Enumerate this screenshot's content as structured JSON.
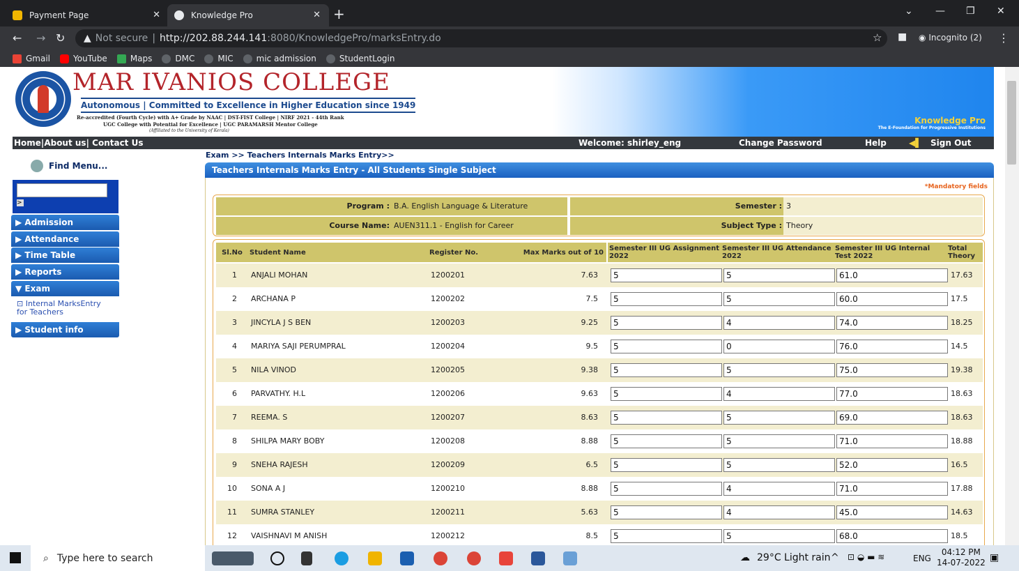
{
  "browser": {
    "tabs": [
      {
        "title": "Payment Page",
        "active": false
      },
      {
        "title": "Knowledge Pro",
        "active": true
      }
    ],
    "security": "Not secure",
    "url_host": "http://202.88.244.141",
    "url_rest": ":8080/KnowledgePro/marksEntry.do",
    "profile": "Incognito (2)",
    "bookmarks": [
      "Gmail",
      "YouTube",
      "Maps",
      "DMC",
      "MIC",
      "mic admission",
      "StudentLogin"
    ]
  },
  "header": {
    "college": "MAR IVANIOS COLLEGE",
    "tagline": "Autonomous | Committed to Excellence in Higher Education since 1949",
    "accreditation": "Re-accredited (Fourth Cycle) with A+ Grade by NAAC | DST-FIST College | NIRF 2021 - 44th Rank",
    "ugc": "UGC College with Potential for Excellence | UGC PARAMARSH Mentor College",
    "affiliation": "(Affiliated to the University of Kerala)",
    "brand": "Knowledge Pro",
    "brand_sub": "The E-Foundation for Progressive Institutions"
  },
  "topnav": {
    "left": "Home|About us| Contact Us",
    "welcome": "Welcome: shirley_eng",
    "change_password": "Change Password",
    "help": "Help",
    "sign_out": "Sign Out"
  },
  "sidebar": {
    "find": "Find Menu...",
    "go": ">",
    "menus": [
      "Admission",
      "Attendance",
      "Time Table",
      "Reports",
      "Exam",
      "Student info"
    ],
    "exam_submenu": "Internal MarksEntry for Teachers"
  },
  "main": {
    "breadcrumb": "Exam >> Teachers Internals Marks Entry>>",
    "panel_title": "Teachers Internals Marks Entry - All Students Single Subject",
    "mandatory": "*Mandatory fields",
    "program_label": "Program :",
    "program": "B.A. English Language & Literature",
    "semester_label": "Semester :",
    "semester": "3",
    "course_label": "Course Name:",
    "course": "AUEN311.1 - English for Career",
    "subject_type_label": "Subject Type :",
    "subject_type": "Theory",
    "columns": [
      "Sl.No",
      "Student Name",
      "Register No.",
      "Max Marks out of 10",
      "Semester III UG Assignment 2022",
      "Semester III UG Attendance 2022",
      "Semester III UG Internal Test 2022",
      "Total Theory"
    ],
    "rows": [
      {
        "sl": "1",
        "name": "ANJALI MOHAN",
        "reg": "1200201",
        "max": "7.63",
        "assign": "5",
        "attend": "5",
        "test": "61.0",
        "total": "17.63"
      },
      {
        "sl": "2",
        "name": "ARCHANA P",
        "reg": "1200202",
        "max": "7.5",
        "assign": "5",
        "attend": "5",
        "test": "60.0",
        "total": "17.5"
      },
      {
        "sl": "3",
        "name": "JINCYLA J S BEN",
        "reg": "1200203",
        "max": "9.25",
        "assign": "5",
        "attend": "4",
        "test": "74.0",
        "total": "18.25"
      },
      {
        "sl": "4",
        "name": "MARIYA SAJI PERUMPRAL",
        "reg": "1200204",
        "max": "9.5",
        "assign": "5",
        "attend": "0",
        "test": "76.0",
        "total": "14.5"
      },
      {
        "sl": "5",
        "name": "NILA VINOD",
        "reg": "1200205",
        "max": "9.38",
        "assign": "5",
        "attend": "5",
        "test": "75.0",
        "total": "19.38"
      },
      {
        "sl": "6",
        "name": "PARVATHY. H.L",
        "reg": "1200206",
        "max": "9.63",
        "assign": "5",
        "attend": "4",
        "test": "77.0",
        "total": "18.63"
      },
      {
        "sl": "7",
        "name": "REEMA. S",
        "reg": "1200207",
        "max": "8.63",
        "assign": "5",
        "attend": "5",
        "test": "69.0",
        "total": "18.63"
      },
      {
        "sl": "8",
        "name": "SHILPA MARY BOBY",
        "reg": "1200208",
        "max": "8.88",
        "assign": "5",
        "attend": "5",
        "test": "71.0",
        "total": "18.88"
      },
      {
        "sl": "9",
        "name": "SNEHA RAJESH",
        "reg": "1200209",
        "max": "6.5",
        "assign": "5",
        "attend": "5",
        "test": "52.0",
        "total": "16.5"
      },
      {
        "sl": "10",
        "name": "SONA A J",
        "reg": "1200210",
        "max": "8.88",
        "assign": "5",
        "attend": "4",
        "test": "71.0",
        "total": "17.88"
      },
      {
        "sl": "11",
        "name": "SUMRA STANLEY",
        "reg": "1200211",
        "max": "5.63",
        "assign": "5",
        "attend": "4",
        "test": "45.0",
        "total": "14.63"
      },
      {
        "sl": "12",
        "name": "VAISHNAVI M ANISH",
        "reg": "1200212",
        "max": "8.5",
        "assign": "5",
        "attend": "5",
        "test": "68.0",
        "total": "18.5"
      }
    ]
  },
  "taskbar": {
    "search_placeholder": "Type here to search",
    "weather": "29°C  Light rain",
    "lang": "ENG",
    "time": "04:12 PM",
    "date": "14-07-2022"
  },
  "colors": {
    "accent": "#1a60c0",
    "header_cell": "#cfc56b",
    "row_alt": "#f3eed0"
  }
}
